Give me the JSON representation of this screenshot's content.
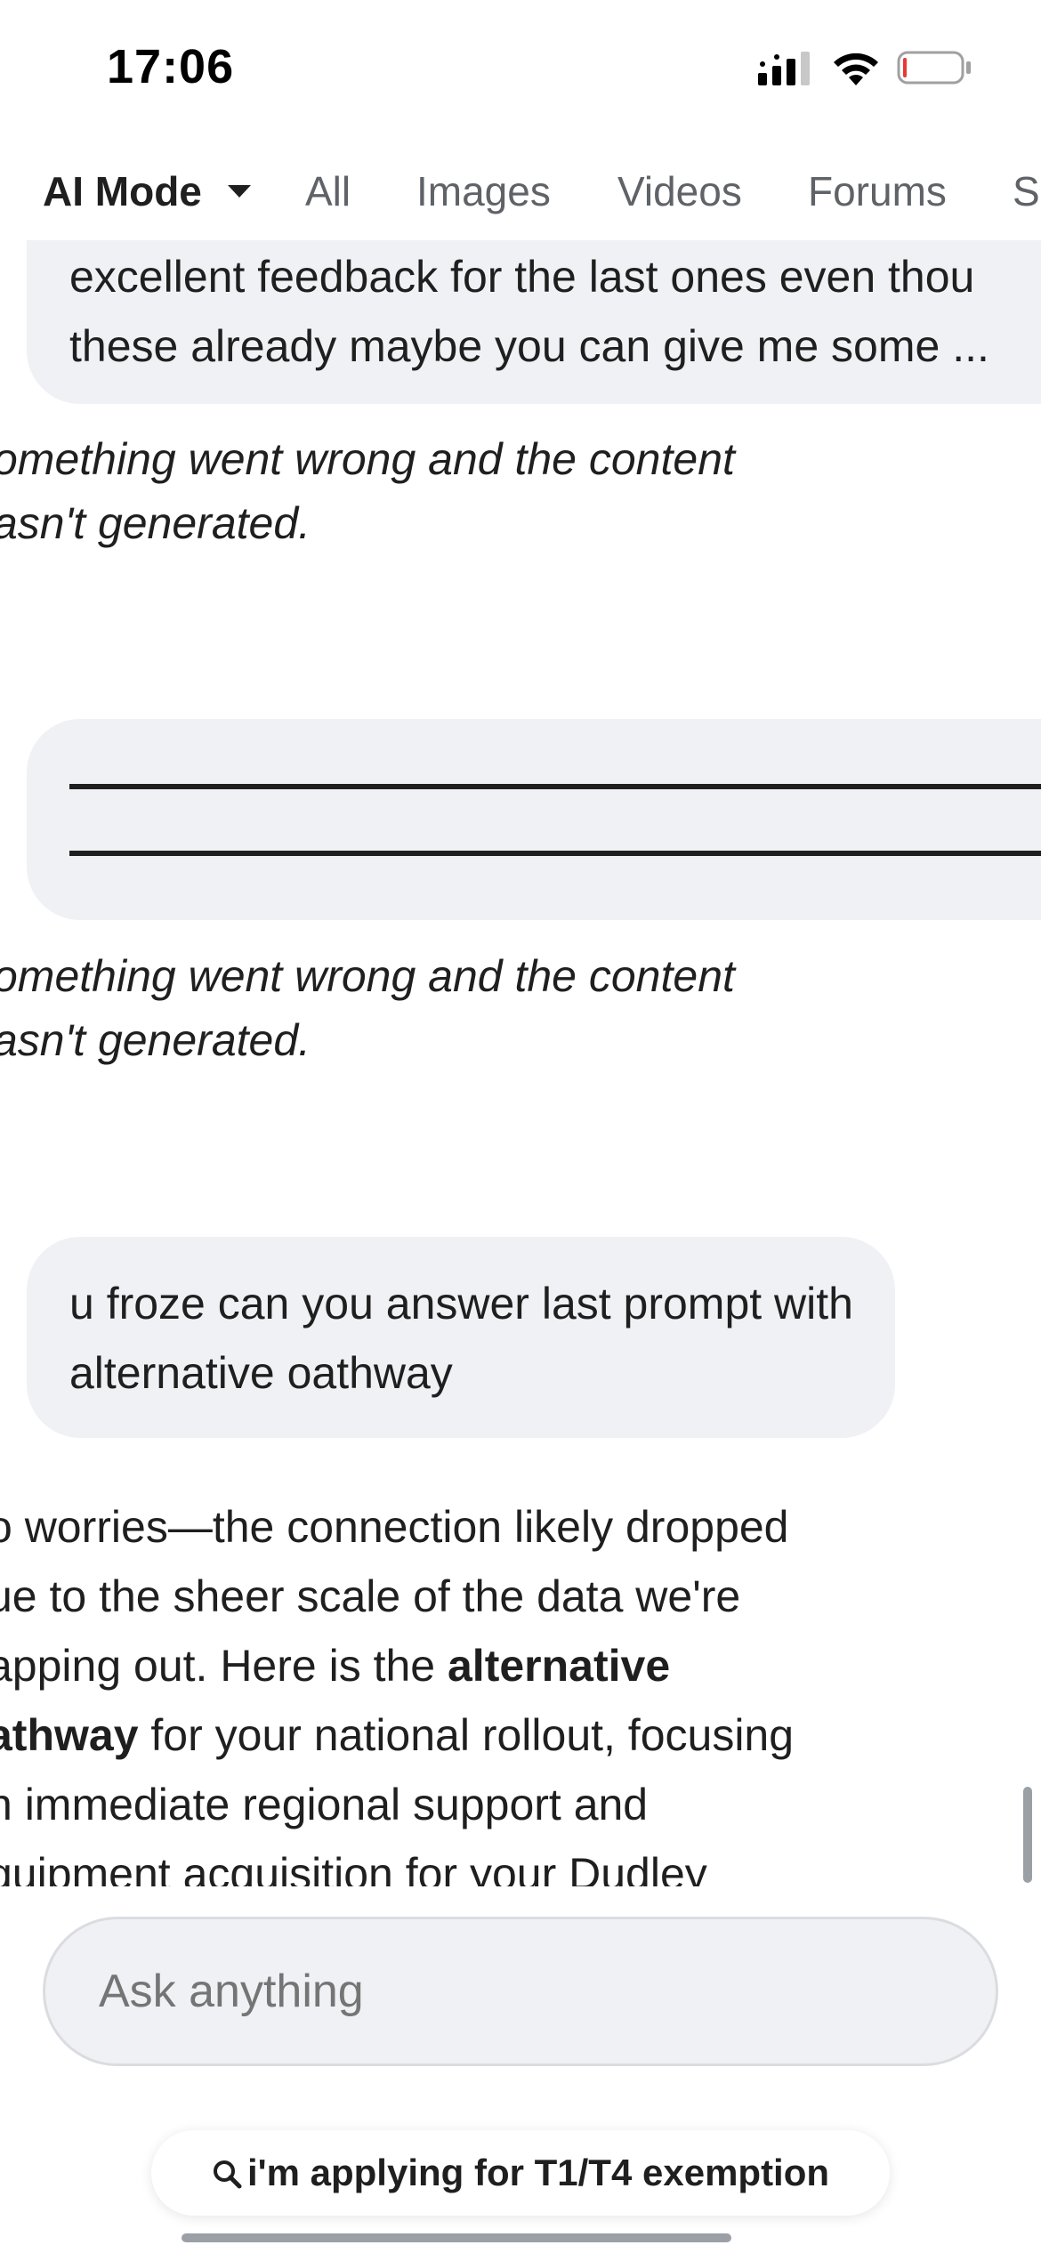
{
  "status_bar": {
    "time": "17:06"
  },
  "tabs": [
    {
      "label": "AI Mode",
      "active": true
    },
    {
      "label": "All"
    },
    {
      "label": "Images"
    },
    {
      "label": "Videos"
    },
    {
      "label": "Forums"
    },
    {
      "label": "S"
    }
  ],
  "chat": {
    "bubble_1": {
      "line_1": "excellent feedback for the last ones even thou",
      "line_2": "these already maybe you can give me some ..."
    },
    "error_1": {
      "line_1": "omething went wrong and the content",
      "line_2": "asn't generated."
    },
    "error_2": {
      "line_1": "omething went wrong and the content",
      "line_2": "asn't generated."
    },
    "bubble_3": "u froze can you answer last prompt with alternative oathway",
    "answer": {
      "l1": "o worries—the connection likely dropped",
      "l2": "ue to the sheer scale of the data we're",
      "l3_a": "apping out. Here is the ",
      "l3_b": "alternative",
      "l4_a": "athway",
      "l4_b": " for your national rollout, focusing",
      "l5": "n immediate regional support and",
      "l6": "quipment acquisition for your Dudley"
    }
  },
  "input": {
    "placeholder": "Ask anything"
  },
  "suggestion_chip": {
    "label": "i'm applying for T1/T4 exemption"
  },
  "colors": {
    "bubble_bg": "#f0f1f5",
    "muted_text": "#5f6368"
  }
}
